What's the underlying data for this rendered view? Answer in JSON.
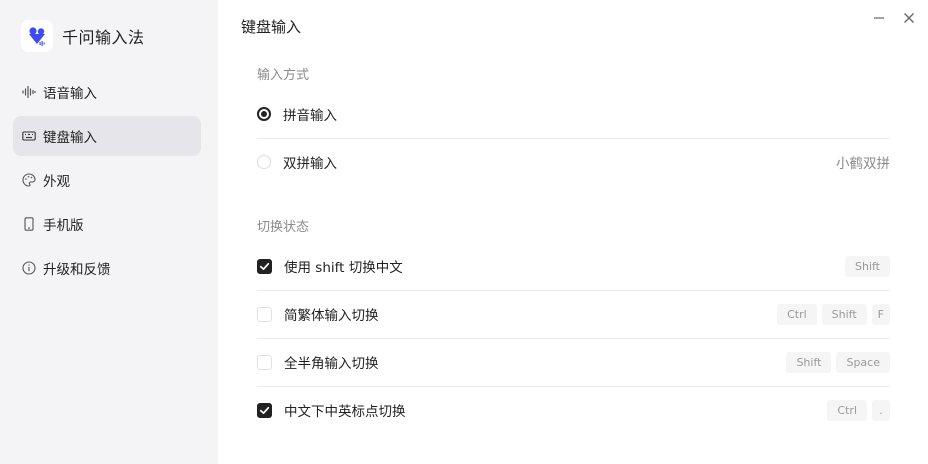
{
  "app": {
    "name": "千问输入法",
    "accent": "#3d4bf5"
  },
  "sidebar": {
    "items": [
      {
        "label": "语音输入",
        "icon": "waveform-icon",
        "active": false
      },
      {
        "label": "键盘输入",
        "icon": "keyboard-icon",
        "active": true
      },
      {
        "label": "外观",
        "icon": "palette-icon",
        "active": false
      },
      {
        "label": "手机版",
        "icon": "phone-icon",
        "active": false
      },
      {
        "label": "升级和反馈",
        "icon": "info-icon",
        "active": false
      }
    ]
  },
  "main": {
    "title": "键盘输入",
    "input_method": {
      "section_title": "输入方式",
      "options": [
        {
          "label": "拼音输入",
          "selected": true,
          "hint": ""
        },
        {
          "label": "双拼输入",
          "selected": false,
          "hint": "小鹤双拼"
        }
      ]
    },
    "toggle_state": {
      "section_title": "切换状态",
      "options": [
        {
          "label": "使用 shift 切换中文",
          "checked": true,
          "keys": [
            "Shift"
          ]
        },
        {
          "label": "简繁体输入切换",
          "checked": false,
          "keys": [
            "Ctrl",
            "Shift",
            "F"
          ]
        },
        {
          "label": "全半角输入切换",
          "checked": false,
          "keys": [
            "Shift",
            "Space"
          ]
        },
        {
          "label": "中文下中英标点切换",
          "checked": true,
          "keys": [
            "Ctrl",
            "."
          ]
        }
      ]
    }
  }
}
